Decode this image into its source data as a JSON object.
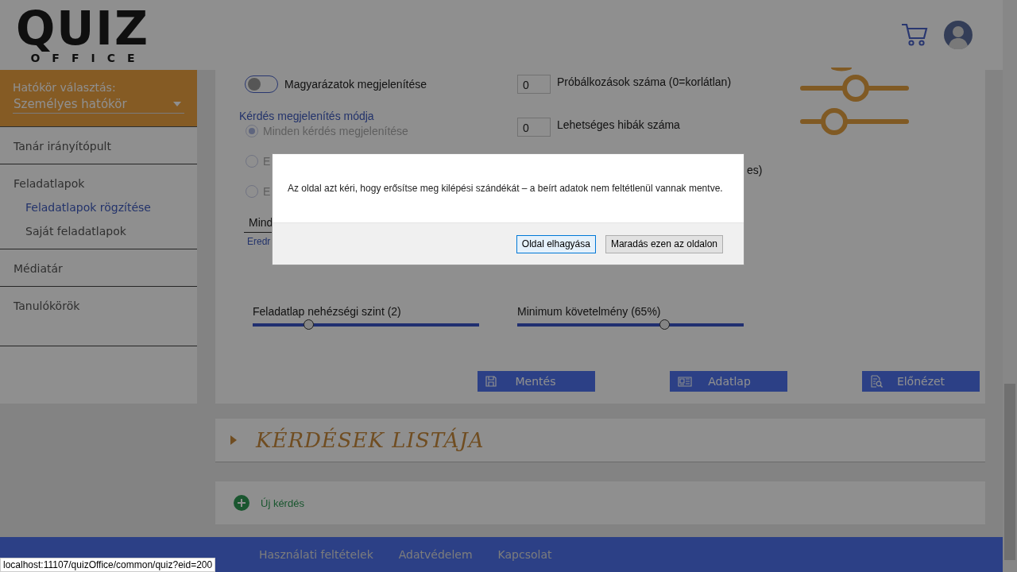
{
  "logo": {
    "word": "QUIZ",
    "subtitle": "OFFICE"
  },
  "sidebar": {
    "scope_label": "Hatókör választás:",
    "scope_value": "Személyes hatókör",
    "items": [
      {
        "label": "Tanár irányítópult",
        "selected": false
      },
      {
        "label": "Feladatlapok",
        "selected": false,
        "children": [
          {
            "label": "Feladatlapok rögzítése",
            "selected": true
          },
          {
            "label": "Saját feladatlapok",
            "selected": false
          }
        ]
      },
      {
        "label": "Médiatár",
        "selected": false
      },
      {
        "label": "Tanulókörök",
        "selected": false
      }
    ]
  },
  "settings": {
    "toggle": {
      "label": "Magyarázatok megjelenítése",
      "on": false
    },
    "display_mode": {
      "title": "Kérdés megjelenítés módja",
      "options": [
        {
          "label": "Minden kérdés megjelenítése",
          "selected": true
        },
        {
          "label": "E",
          "selected": false
        },
        {
          "label": "E",
          "selected": false
        }
      ]
    },
    "select_value": "Mind",
    "link": "Eredr",
    "fields": [
      {
        "value": "0",
        "label": "Próbálkozások száma (0=korlátlan)"
      },
      {
        "value": "0",
        "label": "Lehetséges hibák száma"
      }
    ],
    "partial_label": "es)",
    "sliders": [
      {
        "label": "Feladatlap nehézségi szint (2)",
        "level": 0.245
      },
      {
        "label": "Minimum követelmény (65%)",
        "level": 0.65
      }
    ],
    "buttons": [
      {
        "label": "Mentés",
        "kind": "save"
      },
      {
        "label": "Adatlap",
        "kind": "sheet"
      },
      {
        "label": "Előnézet",
        "kind": "preview"
      }
    ]
  },
  "questions_section": {
    "title": "KÉRDÉSEK LISTÁJA",
    "expanded": false
  },
  "new_question": "Új kérdés",
  "footer": {
    "links": [
      "Használati feltételek",
      "Adatvédelem",
      "Kapcsolat"
    ]
  },
  "dialog": {
    "message": "Az oldal azt kéri, hogy erősítse meg kilépési szándékát – a beírt adatok nem feltétlenül vannak mentve.",
    "buttons": [
      {
        "label": "Oldal elhagyása",
        "selected": true
      },
      {
        "label": "Maradás ezen az oldalon",
        "selected": false
      }
    ]
  },
  "status_url": "localhost:11107/quizOffice/common/quiz?eid=200"
}
